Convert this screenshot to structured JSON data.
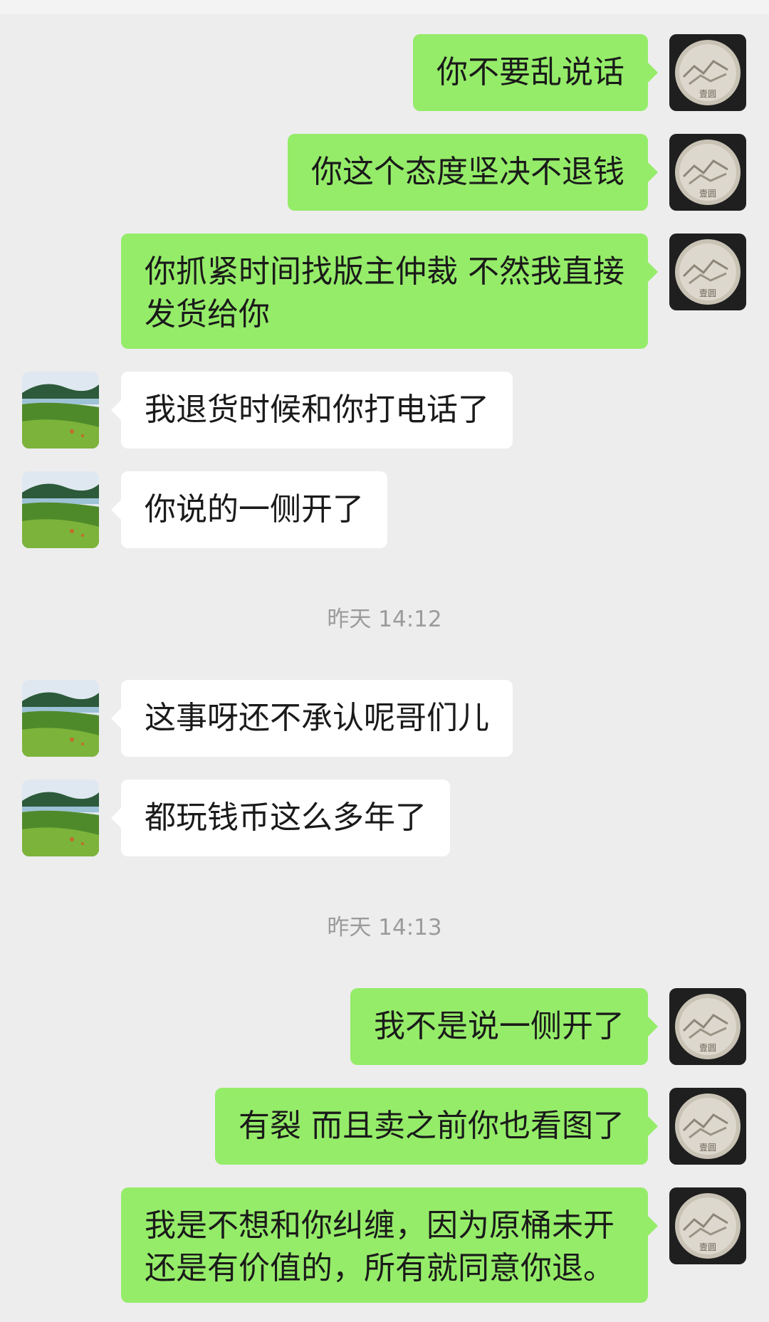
{
  "messages": [
    {
      "side": "out",
      "text": "你不要乱说话"
    },
    {
      "side": "out",
      "text": "你这个态度坚决不退钱"
    },
    {
      "side": "out",
      "text": "你抓紧时间找版主仲裁 不然我直接发货给你"
    },
    {
      "side": "in",
      "text": "我退货时候和你打电话了"
    },
    {
      "side": "in",
      "text": "你说的一侧开了"
    },
    {
      "side": "time",
      "text": "昨天 14:12"
    },
    {
      "side": "in",
      "text": "这事呀还不承认呢哥们儿"
    },
    {
      "side": "in",
      "text": "都玩钱币这么多年了"
    },
    {
      "side": "time",
      "text": "昨天 14:13"
    },
    {
      "side": "out",
      "text": "我不是说一侧开了"
    },
    {
      "side": "out",
      "text": "有裂 而且卖之前你也看图了"
    },
    {
      "side": "out",
      "text": "我是不想和你纠缠，因为原桶未开还是有价值的，所有就同意你退。"
    }
  ],
  "coin_text": "壹圆",
  "colors": {
    "background": "#ededed",
    "outgoing_bubble": "#95ec69",
    "incoming_bubble": "#ffffff",
    "timestamp": "#9b9b9b"
  },
  "icons": {
    "self_avatar": "coin-avatar-icon",
    "contact_avatar": "landscape-avatar-icon"
  }
}
